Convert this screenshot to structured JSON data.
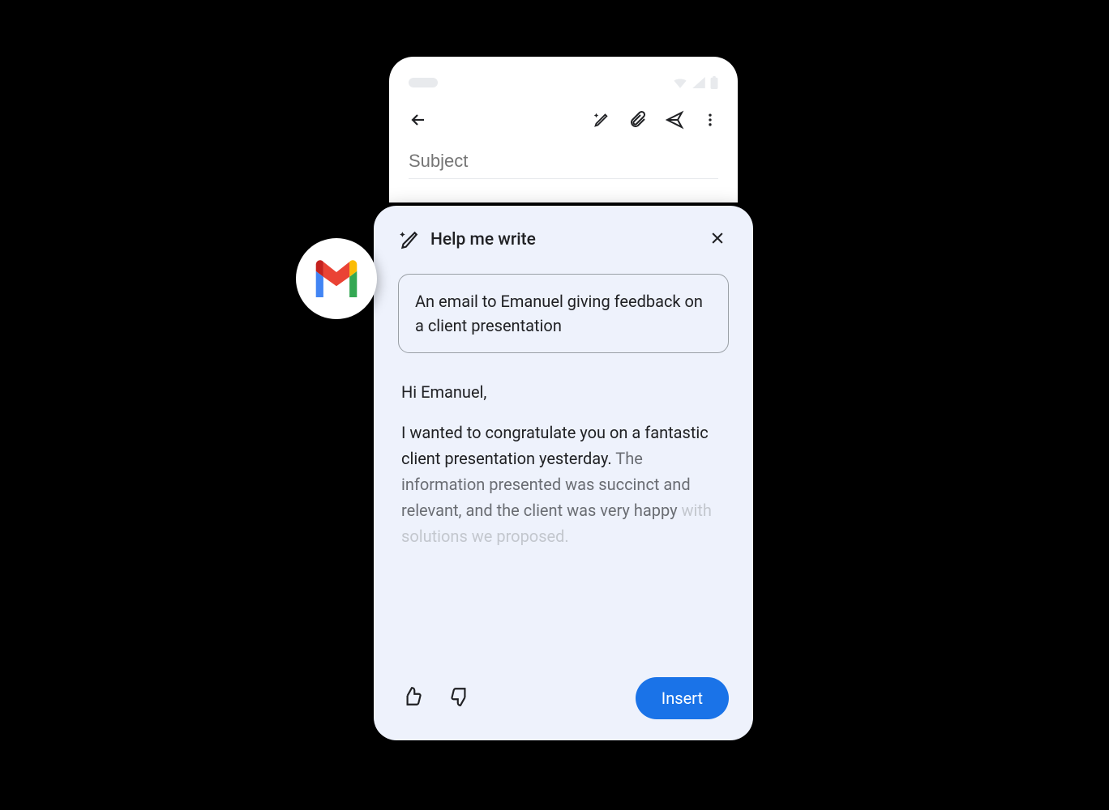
{
  "compose": {
    "subject_placeholder": "Subject"
  },
  "help_panel": {
    "title": "Help me write",
    "prompt": "An email to Emanuel giving feedback on a client presentation",
    "greeting": "Hi Emanuel,",
    "body_line1": "I wanted to congratulate you on a fantastic client presentation yesterday.",
    "body_line2": "The information presented was succinct and relevant, and the client was very happy",
    "body_line3": "with solutions we proposed.",
    "insert_label": "Insert"
  },
  "icons": {
    "gmail": "gmail",
    "magic_pen": "magic-pen",
    "close": "close",
    "thumbs_up": "thumbs-up",
    "thumbs_down": "thumbs-down",
    "back": "back",
    "attach": "attach",
    "send": "send",
    "more": "more"
  }
}
